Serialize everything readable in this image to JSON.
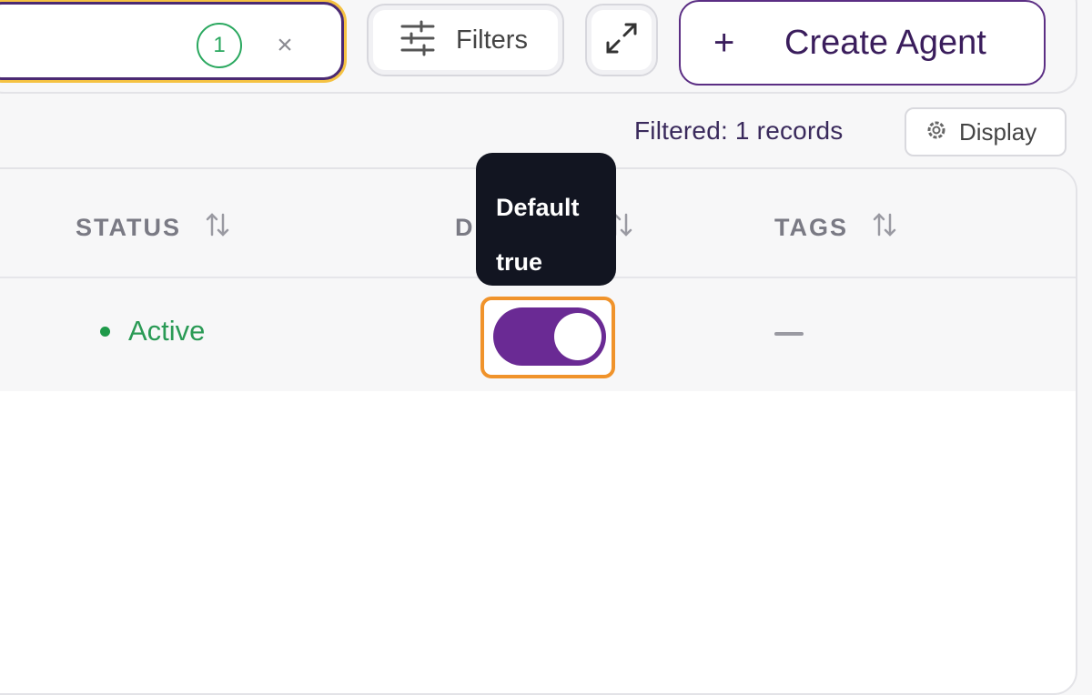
{
  "search": {
    "filter_count": "1",
    "clear_icon": "×"
  },
  "toolbar": {
    "filters_label": "Filters",
    "create_label": "Create Agent",
    "create_icon": "+"
  },
  "summary": {
    "filtered_text": "Filtered: 1 records",
    "display_label": "Display"
  },
  "table": {
    "headers": {
      "status": "STATUS",
      "default": "D",
      "tags": "TAGS"
    },
    "rows": [
      {
        "status": "Active",
        "default": true,
        "tags": ""
      }
    ]
  },
  "tooltip": {
    "line1": "Default",
    "line2": "true"
  },
  "colors": {
    "accent": "#6a2a94",
    "active": "#2a9a55",
    "highlight": "#f0932b",
    "badge": "#2aa85f"
  }
}
